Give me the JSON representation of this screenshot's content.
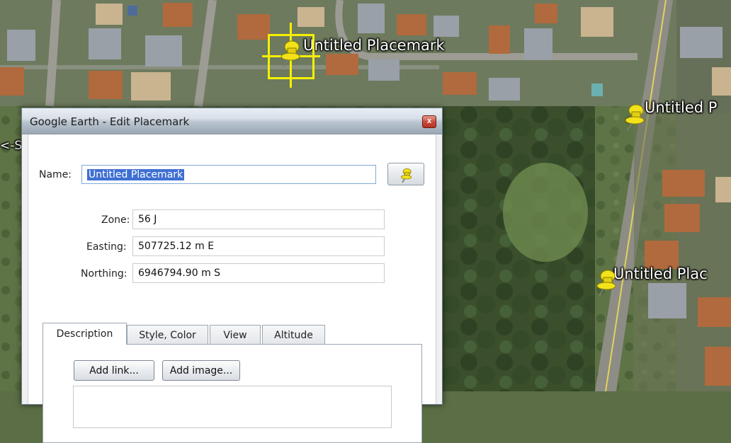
{
  "map": {
    "placemarks": [
      {
        "label": "Untitled Placemark"
      },
      {
        "label": "Untitled P"
      },
      {
        "label": "Untitled Plac"
      }
    ],
    "edge_label": "<-S"
  },
  "dialog": {
    "title": "Google Earth - Edit Placemark",
    "close_glyph": "x",
    "name_label": "Name:",
    "name_value": "Untitled Placemark",
    "fields": {
      "zone_label": "Zone:",
      "zone_value": "56 J",
      "easting_label": "Easting:",
      "easting_value": "507725.12 m E",
      "northing_label": "Northing:",
      "northing_value": "6946794.90 m S"
    },
    "tabs": [
      {
        "label": "Description",
        "active": true
      },
      {
        "label": "Style, Color",
        "active": false
      },
      {
        "label": "View",
        "active": false
      },
      {
        "label": "Altitude",
        "active": false
      }
    ],
    "add_link_label": "Add link...",
    "add_image_label": "Add image...",
    "pin_icon": "pushpin-icon"
  },
  "colors": {
    "pin": "#f3e21a",
    "selection": "#f5f000",
    "name_selection": "#3f6fd3"
  }
}
